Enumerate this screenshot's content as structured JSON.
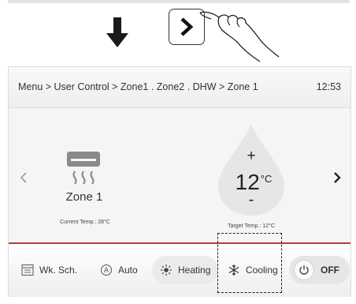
{
  "header": {
    "breadcrumb": "Menu > User Control > Zone1 . Zone2 . DHW > Zone 1",
    "time": "12:53"
  },
  "zone": {
    "name": "Zone 1",
    "current_temp": "Current Temp.: 28°C"
  },
  "setpoint": {
    "plus": "+",
    "value": "12",
    "unit": "°C",
    "minus": "-",
    "target_temp": "Target Temp.: 12°C"
  },
  "footer": {
    "wk_sch": "Wk. Sch.",
    "auto": "Auto",
    "heating": "Heating",
    "cooling": "Cooling",
    "off": "OFF"
  },
  "colors": {
    "accent_line": "#c0392b",
    "drop": "#e6e6e6"
  },
  "icons": [
    "down-arrow-icon",
    "right-chevron-icon",
    "pointing-hand-icon",
    "left-chevron-icon",
    "air-conditioner-icon",
    "calendar-icon",
    "auto-mode-icon",
    "sun-icon",
    "snowflake-icon",
    "power-icon"
  ]
}
